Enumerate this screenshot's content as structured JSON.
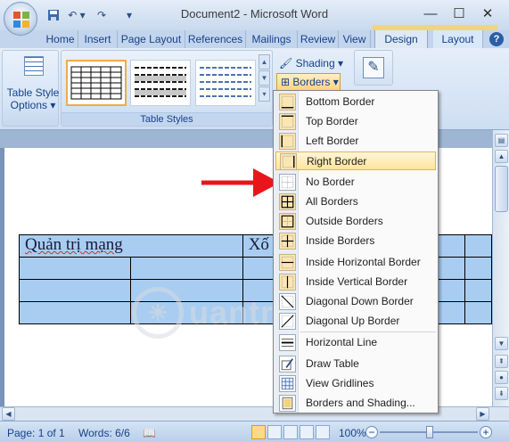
{
  "window": {
    "title": "Document2 - Microsoft Word"
  },
  "tabs": [
    {
      "label": "Home"
    },
    {
      "label": "Insert"
    },
    {
      "label": "Page Layout"
    },
    {
      "label": "References"
    },
    {
      "label": "Mailings"
    },
    {
      "label": "Review"
    },
    {
      "label": "View"
    },
    {
      "label": "Design"
    },
    {
      "label": "Layout"
    }
  ],
  "ribbon": {
    "table_style_options": "Table Style Options",
    "table_styles_label": "Table Styles",
    "shading_label": "Shading",
    "borders_label": "Borders"
  },
  "document": {
    "table": {
      "rows": [
        [
          "Quản trị mạng",
          "",
          "Xố",
          "",
          ""
        ],
        [
          "",
          "",
          "",
          "",
          ""
        ],
        [
          "",
          "",
          "",
          "",
          ""
        ],
        [
          "",
          "",
          "",
          "",
          ""
        ]
      ]
    }
  },
  "borders_menu": {
    "items": [
      {
        "label": "Bottom Border",
        "hot": "B",
        "rest": "ottom Border"
      },
      {
        "label": "Top Border",
        "hot": "T",
        "rest": "op Border",
        "pre": ""
      },
      {
        "label": "Left Border",
        "hot": "L",
        "rest": "eft Border"
      },
      {
        "label": "Right Border",
        "hot": "R",
        "rest": "ight Border"
      },
      {
        "label": "No Border",
        "hot": "N",
        "rest": "o Border"
      },
      {
        "label": "All Borders",
        "hot": "A",
        "rest": "ll Borders"
      },
      {
        "label": "Outside Borders",
        "hot": "S",
        "rest": "Outside Borders"
      },
      {
        "label": "Inside Borders",
        "hot": "I",
        "rest": "nside Borders"
      },
      {
        "label": "Inside Horizontal Border"
      },
      {
        "label": "Inside Vertical Border"
      },
      {
        "label": "Diagonal Down Border"
      },
      {
        "label": "Diagonal Up Border"
      },
      {
        "label": "Horizontal Line"
      },
      {
        "label": "Draw Table"
      },
      {
        "label": "View Gridlines"
      },
      {
        "label": "Borders and Shading..."
      }
    ]
  },
  "watermark": {
    "text": "uantrimang"
  },
  "status_bar": {
    "page": "Page: 1 of 1",
    "words": "Words: 6/6",
    "zoom": "100%"
  },
  "colors": {
    "highlight": "#ffe49a",
    "table_fill": "#a9cdf0",
    "arrow": "#e8161b"
  }
}
